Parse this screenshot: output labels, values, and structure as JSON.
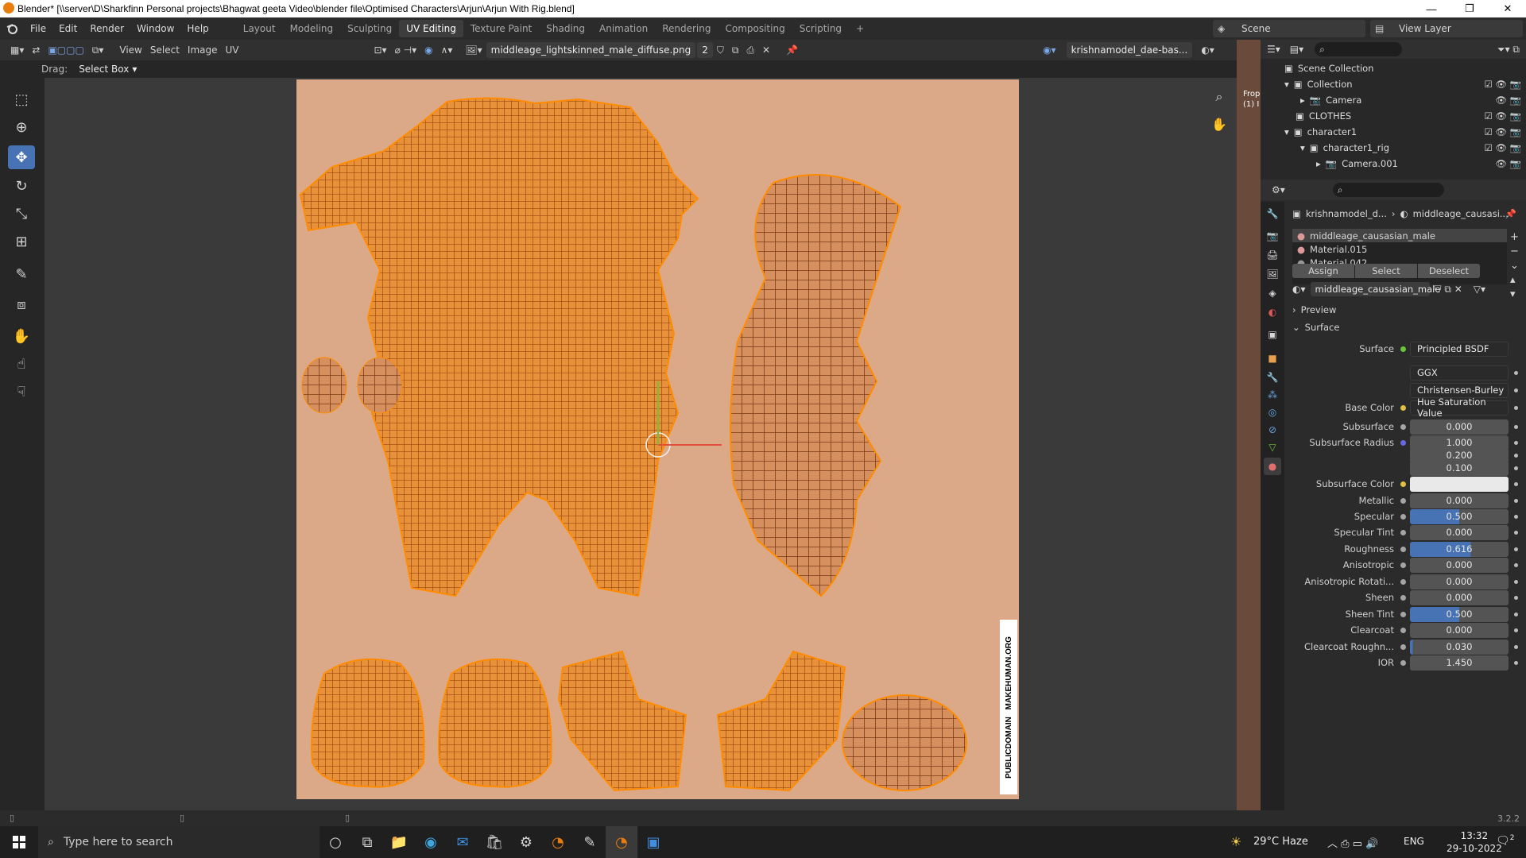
{
  "window": {
    "title": "Blender* [\\\\server\\D\\Sharkfinn Personal projects\\Bhagwat geeta Video\\blender file\\Optimised Characters\\Arjun\\Arjun With Rig.blend]",
    "minimize": "—",
    "maximize": "❐",
    "close": "✕"
  },
  "topbar": {
    "menus": [
      "File",
      "Edit",
      "Render",
      "Window",
      "Help"
    ],
    "workspaces": [
      "Layout",
      "Modeling",
      "Sculpting",
      "UV Editing",
      "Texture Paint",
      "Shading",
      "Animation",
      "Rendering",
      "Compositing",
      "Scripting"
    ],
    "active_workspace": "UV Editing",
    "add_workspace": "+",
    "scene_label": "Scene",
    "view_layer_label": "View Layer"
  },
  "uv_header": {
    "menus": [
      "View",
      "Select",
      "Image",
      "UV"
    ],
    "image_name": "middleage_lightskinned_male_diffuse.png",
    "users": "2",
    "object_name": "krishnamodel_dae-bas..."
  },
  "tool_header": {
    "drag_label": "Drag:",
    "drag_mode": "Select Box"
  },
  "texture_watermark": "MAKEHUMAN.ORG",
  "texture_watermark2": "PUBLICDOMAIN",
  "outliner": {
    "rows": [
      {
        "label": "Scene Collection"
      },
      {
        "label": "Collection"
      },
      {
        "label": "Camera"
      },
      {
        "label": "CLOTHES"
      },
      {
        "label": "character1"
      },
      {
        "label": "character1_rig"
      },
      {
        "label": "Camera.001"
      }
    ]
  },
  "viewport_text": {
    "l1": "Frop",
    "l2": "(1) I"
  },
  "properties": {
    "breadcrumb_object": "krishnamodel_d...",
    "breadcrumb_material": "middleage_causasi...",
    "material_slots": [
      "middleage_causasian_male",
      "Material.015",
      "Material.042"
    ],
    "assign": "Assign",
    "select": "Select",
    "deselect": "Deselect",
    "material_name": "middleage_causasian_male",
    "preview": "Preview",
    "surface_panel": "Surface",
    "surface_label": "Surface",
    "surface_value": "Principled BSDF",
    "distribution": "GGX",
    "subsurface_method": "Christensen-Burley",
    "params": [
      {
        "label": "Base Color",
        "value": "Hue Saturation Value",
        "kind": "link",
        "fill": 0
      },
      {
        "label": "Subsurface",
        "value": "0.000",
        "kind": "num",
        "fill": 0
      },
      {
        "label": "Subsurface Radius",
        "value": "1.000",
        "kind": "num",
        "fill": 0
      },
      {
        "label": "",
        "value": "0.200",
        "kind": "num",
        "fill": 0
      },
      {
        "label": "",
        "value": "0.100",
        "kind": "num",
        "fill": 0
      },
      {
        "label": "Subsurface Color",
        "value": "",
        "kind": "color",
        "fill": 0
      },
      {
        "label": "Metallic",
        "value": "0.000",
        "kind": "num",
        "fill": 0
      },
      {
        "label": "Specular",
        "value": "0.500",
        "kind": "num",
        "fill": 0.5
      },
      {
        "label": "Specular Tint",
        "value": "0.000",
        "kind": "num",
        "fill": 0
      },
      {
        "label": "Roughness",
        "value": "0.616",
        "kind": "num",
        "fill": 0.616
      },
      {
        "label": "Anisotropic",
        "value": "0.000",
        "kind": "num",
        "fill": 0
      },
      {
        "label": "Anisotropic Rotati...",
        "value": "0.000",
        "kind": "num",
        "fill": 0
      },
      {
        "label": "Sheen",
        "value": "0.000",
        "kind": "num",
        "fill": 0
      },
      {
        "label": "Sheen Tint",
        "value": "0.500",
        "kind": "num",
        "fill": 0.5
      },
      {
        "label": "Clearcoat",
        "value": "0.000",
        "kind": "num",
        "fill": 0
      },
      {
        "label": "Clearcoat Roughn...",
        "value": "0.030",
        "kind": "num",
        "fill": 0.03
      },
      {
        "label": "IOR",
        "value": "1.450",
        "kind": "num",
        "fill": 0
      }
    ]
  },
  "statusbar": {
    "version": "3.2.2"
  },
  "taskbar": {
    "search_placeholder": "Type here to search",
    "weather": "29°C  Haze",
    "lang": "ENG",
    "time": "13:32",
    "date": "29-10-2022",
    "notif": "2"
  },
  "colors": {
    "accent": "#4772b3",
    "uv_orange": "#ff8c00",
    "skin": "#dba988"
  }
}
